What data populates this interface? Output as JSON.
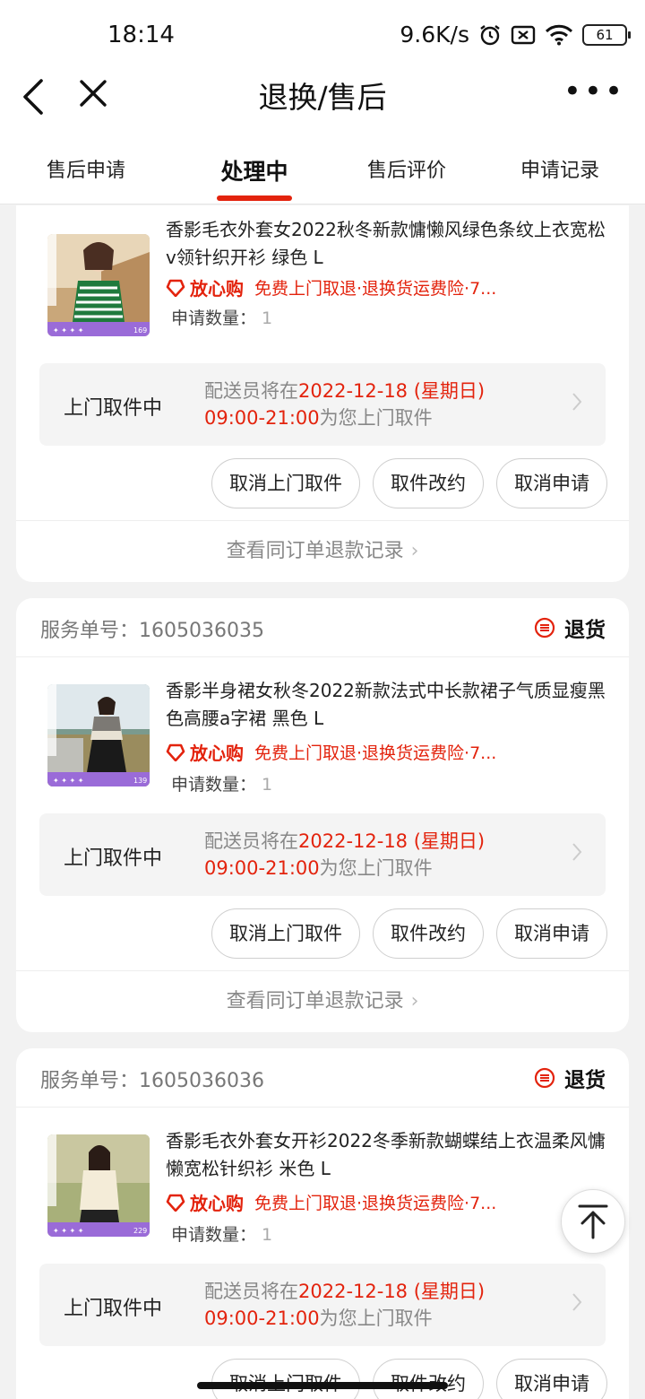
{
  "status_bar": {
    "time": "18:14",
    "network_speed": "9.6K/s",
    "battery": "61"
  },
  "nav": {
    "title": "退换/售后",
    "more": "•••"
  },
  "tabs": [
    {
      "label": "售后申请"
    },
    {
      "label": "处理中"
    },
    {
      "label": "售后评价"
    },
    {
      "label": "申请记录"
    }
  ],
  "accent_color": "#e3230d",
  "cards": [
    {
      "title": "香影毛衣外套女2022秋冬新款慵懒风绿色条纹上衣宽松v领针织开衫 绿色 L",
      "assurance_badge": "放心购",
      "assurance_text": "免费上门取退·退换货运费险·7...",
      "qty_label": "申请数量：",
      "qty": "1",
      "thumb_price": "169",
      "pickup_status": "上门取件中",
      "pickup_prefix": "配送员将在",
      "pickup_date": "2022-12-18 (星期日)",
      "pickup_time": "09:00-21:00",
      "pickup_suffix": "为您上门取件",
      "buttons": [
        "取消上门取件",
        "取件改约",
        "取消申请"
      ],
      "footer": "查看同订单退款记录"
    },
    {
      "service_label": "服务单号：",
      "service_no": "1605036035",
      "type": "退货",
      "title": "香影半身裙女秋冬2022新款法式中长款裙子气质显瘦黑色高腰a字裙 黑色 L",
      "assurance_badge": "放心购",
      "assurance_text": "免费上门取退·退换货运费险·7...",
      "qty_label": "申请数量：",
      "qty": "1",
      "thumb_price": "139",
      "pickup_status": "上门取件中",
      "pickup_prefix": "配送员将在",
      "pickup_date": "2022-12-18 (星期日)",
      "pickup_time": "09:00-21:00",
      "pickup_suffix": "为您上门取件",
      "buttons": [
        "取消上门取件",
        "取件改约",
        "取消申请"
      ],
      "footer": "查看同订单退款记录"
    },
    {
      "service_label": "服务单号：",
      "service_no": "1605036036",
      "type": "退货",
      "title": "香影毛衣外套女开衫2022冬季新款蝴蝶结上衣温柔风慵懒宽松针织衫 米色 L",
      "assurance_badge": "放心购",
      "assurance_text": "免费上门取退·退换货运费险·7...",
      "qty_label": "申请数量：",
      "qty": "1",
      "thumb_price": "229",
      "pickup_status": "上门取件中",
      "pickup_prefix": "配送员将在",
      "pickup_date": "2022-12-18 (星期日)",
      "pickup_time": "09:00-21:00",
      "pickup_suffix": "为您上门取件",
      "buttons": [
        "取消上门取件",
        "取件改约",
        "取消申请"
      ]
    }
  ]
}
